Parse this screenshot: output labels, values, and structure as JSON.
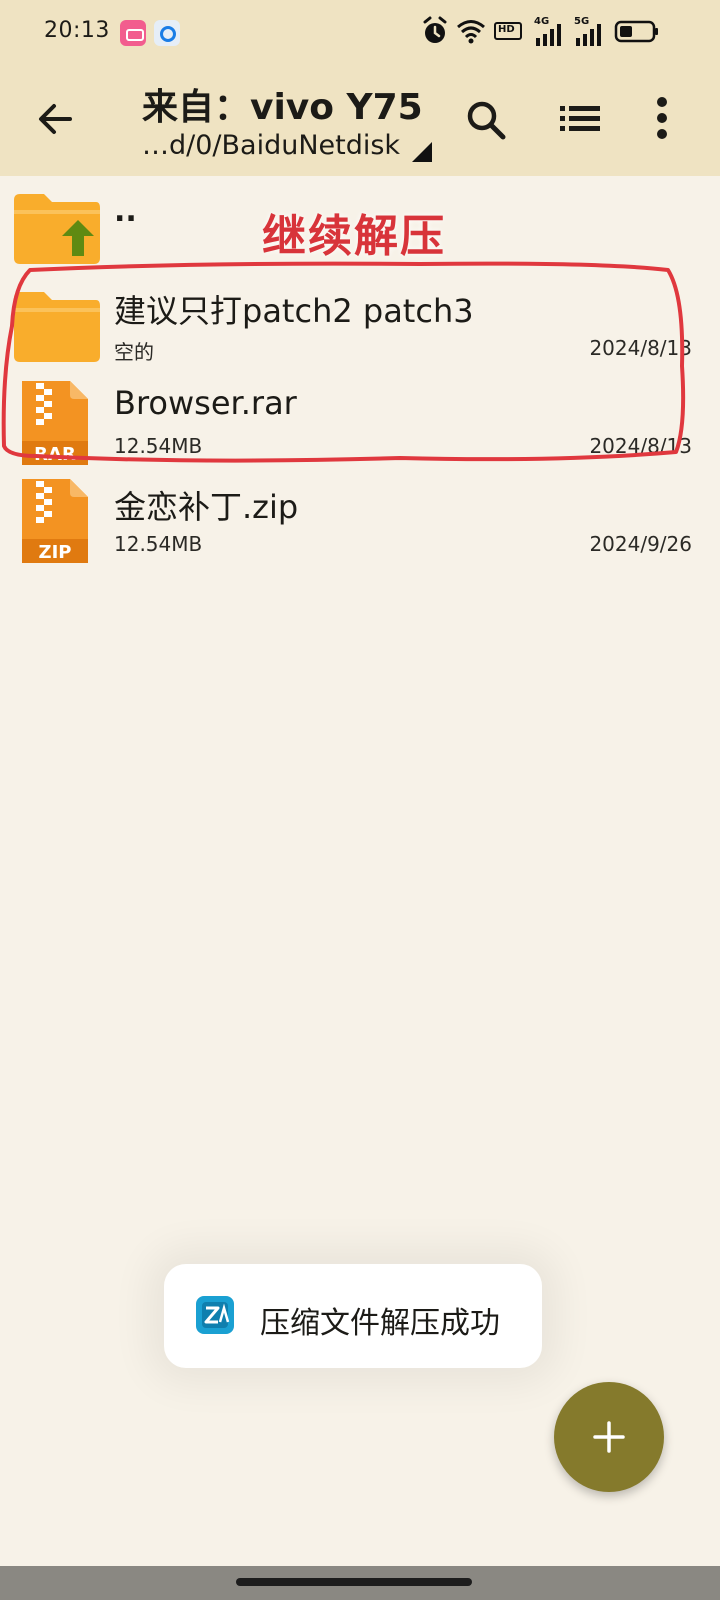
{
  "status_bar": {
    "time": "20:13",
    "app_icons": [
      "bilibili-icon",
      "app-q-icon"
    ],
    "hd_label": "HD",
    "net1_label": "4G",
    "net2_label": "5G"
  },
  "header": {
    "title": "来自：vivo Y75",
    "path": "…d/0/BaiduNetdisk",
    "icons": [
      "back-arrow-icon",
      "search-icon",
      "list-view-icon",
      "more-vert-icon"
    ]
  },
  "files": [
    {
      "type": "parent",
      "name": "..",
      "meta": "",
      "date": "",
      "icon": "folder-up-icon"
    },
    {
      "type": "folder",
      "name": "建议只打patch2 patch3",
      "meta": "空的",
      "date": "2024/8/13",
      "icon": "folder-icon"
    },
    {
      "type": "rar",
      "name": "Browser.rar",
      "meta": "12.54MB",
      "date": "2024/8/13",
      "icon": "rar-file-icon",
      "badge": "RAR"
    },
    {
      "type": "zip",
      "name": "金恋补丁.zip",
      "meta": "12.54MB",
      "date": "2024/9/26",
      "icon": "zip-file-icon",
      "badge": "ZIP"
    }
  ],
  "annotation": {
    "text": "继续解压",
    "color": "#d8343a"
  },
  "toast": {
    "message": "压缩文件解压成功",
    "icon": "zarchiver-icon"
  },
  "fab": {
    "icon": "plus-icon"
  },
  "colors": {
    "header_bg": "#efe3c2",
    "body_bg": "#f7f2e8",
    "fab": "#857a2c",
    "folder": "#f9ad2c",
    "archive": "#f39322"
  }
}
